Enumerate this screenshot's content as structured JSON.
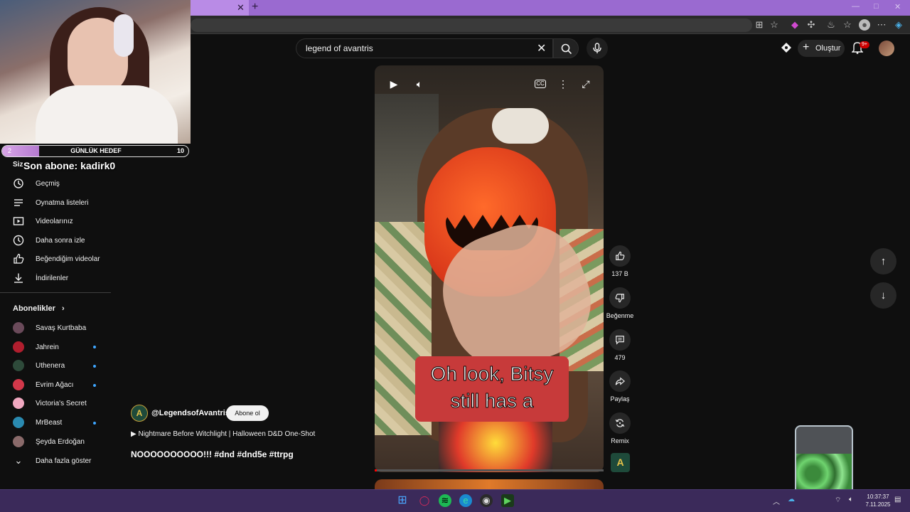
{
  "browser": {
    "tab_close": "✕",
    "new_tab": "+"
  },
  "search": {
    "query": "legend of avantris"
  },
  "header": {
    "create_label": "Oluştur",
    "notification_badge": "9+"
  },
  "overlay": {
    "goal_start": "2",
    "goal_label": "GÜNLÜK HEDEF",
    "goal_end": "10",
    "goal_progress": 0.2,
    "last_sub": "Son abone: kadirk0"
  },
  "sidebar": {
    "section_you": "Siz",
    "you_items": [
      {
        "label": "Geçmiş",
        "icon": "history-icon"
      },
      {
        "label": "Oynatma listeleri",
        "icon": "playlist-icon"
      },
      {
        "label": "Videolarınız",
        "icon": "your-videos-icon"
      },
      {
        "label": "Daha sonra izle",
        "icon": "watch-later-icon"
      },
      {
        "label": "Beğendiğim videolar",
        "icon": "liked-icon"
      },
      {
        "label": "İndirilenler",
        "icon": "download-icon"
      }
    ],
    "subs_heading": "Abonelikler",
    "subs": [
      {
        "label": "Savaş Kurtbaba",
        "color": "#6a4a5a",
        "live": false
      },
      {
        "label": "Jahrein",
        "color": "#b01e2e",
        "live": true
      },
      {
        "label": "Uthenera",
        "color": "#2e4a3a",
        "live": true
      },
      {
        "label": "Evrim Ağacı",
        "color": "#d2384a",
        "live": true
      },
      {
        "label": "Victoria's Secret",
        "color": "#f0a8c0",
        "live": false
      },
      {
        "label": "MrBeast",
        "color": "#2a8ab0",
        "live": true
      },
      {
        "label": "Şeyda Erdoğan",
        "color": "#8a6a6a",
        "live": false
      }
    ],
    "show_more": "Daha fazla göster"
  },
  "short": {
    "caption_line1": "Oh look, Bitsy",
    "caption_line2": "still has a",
    "channel": "@LegendsofAvantris",
    "channel_initial": "A",
    "subscribe": "Abone ol",
    "linked_video": "▶ Nightmare Before Witchlight | Halloween D&D One-Shot",
    "title": "NOOOOOOOOOO!!! #dnd #dnd5e #ttrpg",
    "progress": 0.01
  },
  "actions": {
    "likes": "137 B",
    "dislike": "Beğenme",
    "comments": "479",
    "share": "Paylaş",
    "remix": "Remix"
  },
  "taskbar": {
    "time": "10:37:37",
    "date": "7.11.2025"
  },
  "colors": {
    "accent": "#ff0000",
    "tabbar": "#9a6ad0",
    "taskbar": "#3b2a5a",
    "link_dot": "#3ea6ff"
  }
}
